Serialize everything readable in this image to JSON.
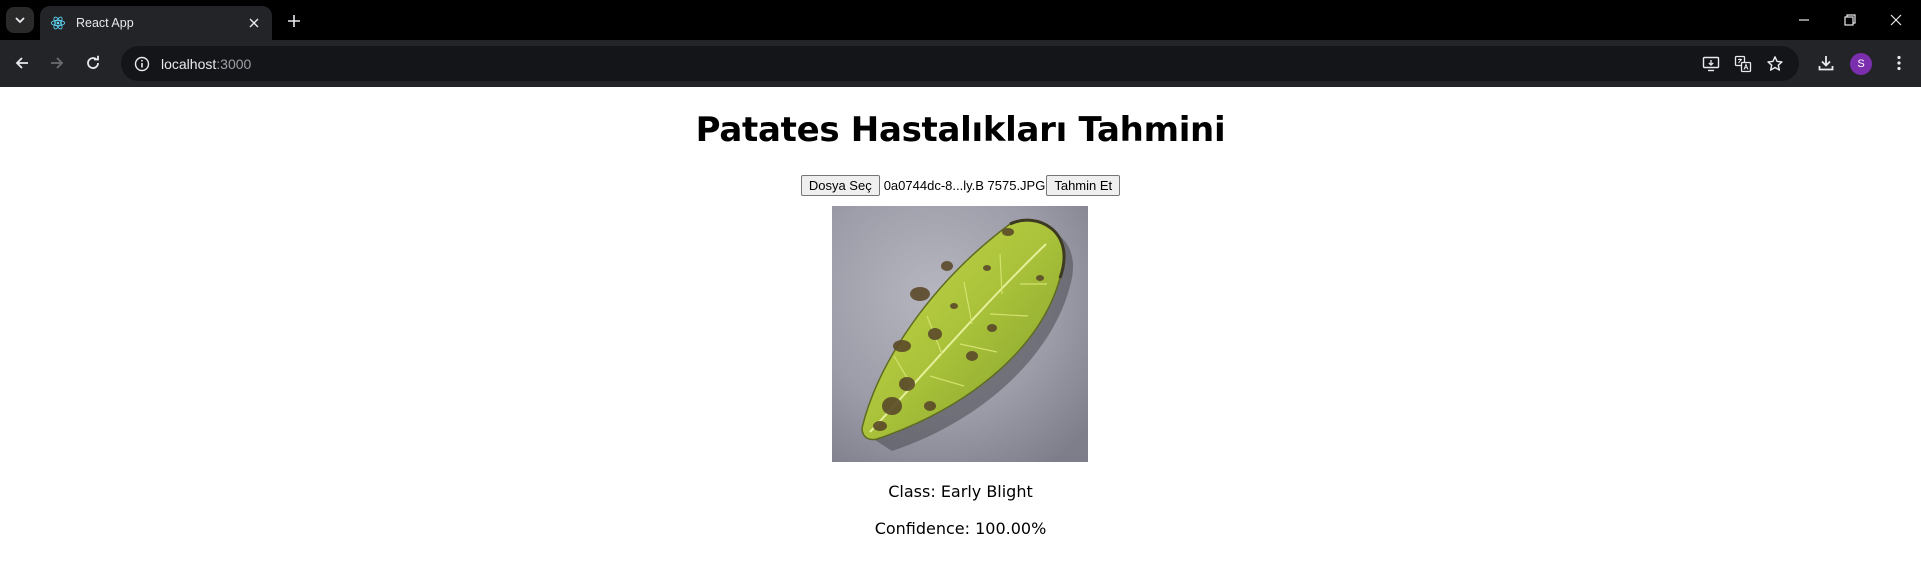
{
  "browser": {
    "tab_title": "React App",
    "url_host": "localhost",
    "url_port": ":3000",
    "profile_initial": "S",
    "accent_color": "#7b2fae"
  },
  "page": {
    "title": "Patates Hastalıkları Tahmini",
    "choose_file_label": "Dosya Seç",
    "file_name": "0a0744dc-8...ly.B 7575.JPG",
    "predict_label": "Tahmin Et",
    "class_text": "Class: Early Blight",
    "confidence_text": "Confidence: 100.00%"
  }
}
